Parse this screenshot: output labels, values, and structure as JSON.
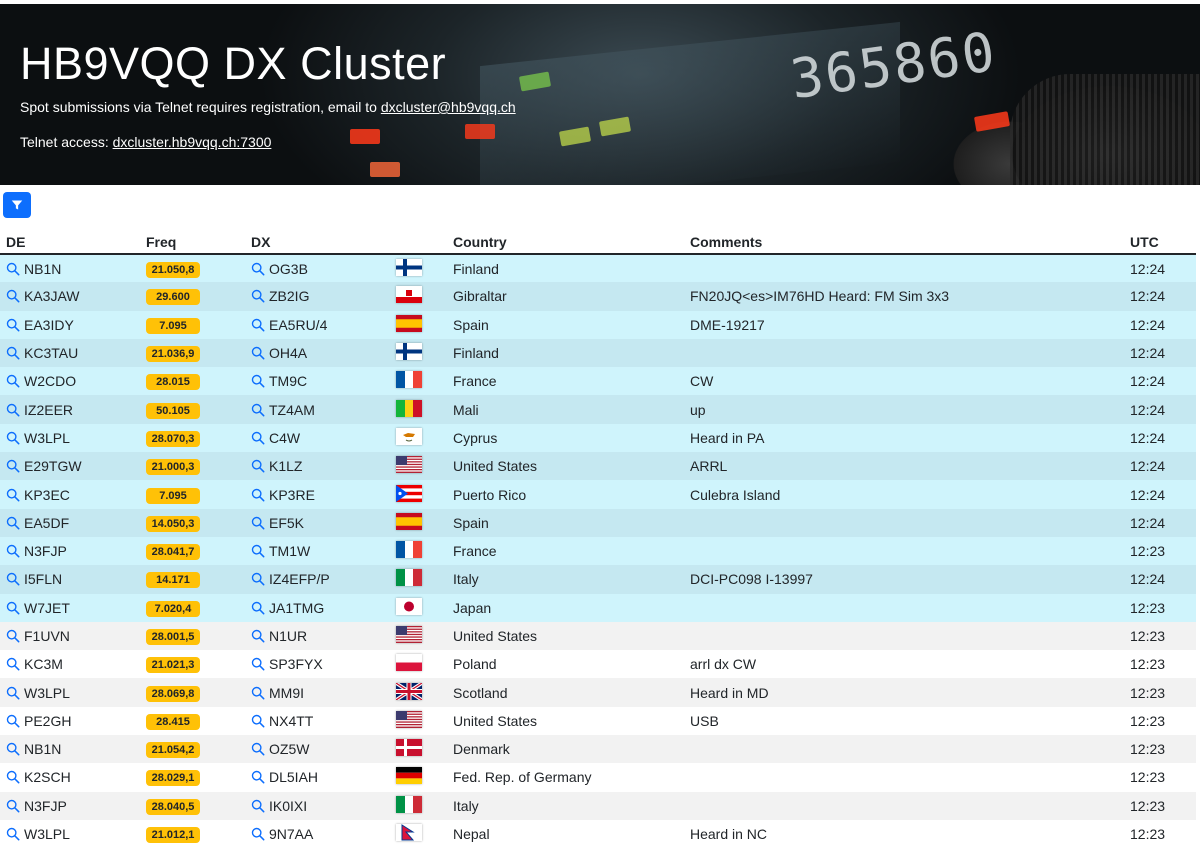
{
  "header": {
    "title": "HB9VQQ DX Cluster",
    "registration_text": "Spot submissions via Telnet requires registration, email to ",
    "email": "dxcluster@hb9vqq.ch",
    "telnet_label": "Telnet access: ",
    "telnet_address": "dxcluster.hb9vqq.ch:7300",
    "radio_display": "365860"
  },
  "filter_button": {
    "icon": "filter-icon",
    "color": "#0d6efd"
  },
  "colors": {
    "freq_badge": "#ffc107",
    "highlight_row": "#cff4fc",
    "link_icon": "#0d6efd"
  },
  "table": {
    "columns": [
      "DE",
      "Freq",
      "DX",
      "",
      "Country",
      "Comments",
      "UTC"
    ],
    "rows": [
      {
        "de": "NB1N",
        "freq": "21.050,8",
        "dx": "OG3B",
        "flag": "finland",
        "country": "Finland",
        "comments": "",
        "utc": "12:24",
        "highlight": true
      },
      {
        "de": "KA3JAW",
        "freq": "29.600",
        "dx": "ZB2IG",
        "flag": "gibraltar",
        "country": "Gibraltar",
        "comments": "FN20JQ<es>IM76HD Heard: FM Sim 3x3",
        "utc": "12:24",
        "highlight": true
      },
      {
        "de": "EA3IDY",
        "freq": "7.095",
        "dx": "EA5RU/4",
        "flag": "spain",
        "country": "Spain",
        "comments": "DME-19217",
        "utc": "12:24",
        "highlight": true
      },
      {
        "de": "KC3TAU",
        "freq": "21.036,9",
        "dx": "OH4A",
        "flag": "finland",
        "country": "Finland",
        "comments": "",
        "utc": "12:24",
        "highlight": true
      },
      {
        "de": "W2CDO",
        "freq": "28.015",
        "dx": "TM9C",
        "flag": "france",
        "country": "France",
        "comments": "CW",
        "utc": "12:24",
        "highlight": true
      },
      {
        "de": "IZ2EER",
        "freq": "50.105",
        "dx": "TZ4AM",
        "flag": "mali",
        "country": "Mali",
        "comments": "up",
        "utc": "12:24",
        "highlight": true
      },
      {
        "de": "W3LPL",
        "freq": "28.070,3",
        "dx": "C4W",
        "flag": "cyprus",
        "country": "Cyprus",
        "comments": "Heard in PA",
        "utc": "12:24",
        "highlight": true
      },
      {
        "de": "E29TGW",
        "freq": "21.000,3",
        "dx": "K1LZ",
        "flag": "usa",
        "country": "United States",
        "comments": "ARRL",
        "utc": "12:24",
        "highlight": true
      },
      {
        "de": "KP3EC",
        "freq": "7.095",
        "dx": "KP3RE",
        "flag": "puertorico",
        "country": "Puerto Rico",
        "comments": "Culebra Island",
        "utc": "12:24",
        "highlight": true
      },
      {
        "de": "EA5DF",
        "freq": "14.050,3",
        "dx": "EF5K",
        "flag": "spain",
        "country": "Spain",
        "comments": "",
        "utc": "12:24",
        "highlight": true
      },
      {
        "de": "N3FJP",
        "freq": "28.041,7",
        "dx": "TM1W",
        "flag": "france",
        "country": "France",
        "comments": "",
        "utc": "12:23",
        "highlight": true
      },
      {
        "de": "I5FLN",
        "freq": "14.171",
        "dx": "IZ4EFP/P",
        "flag": "italy",
        "country": "Italy",
        "comments": "DCI-PC098 I-13997",
        "utc": "12:24",
        "highlight": true
      },
      {
        "de": "W7JET",
        "freq": "7.020,4",
        "dx": "JA1TMG",
        "flag": "japan",
        "country": "Japan",
        "comments": "",
        "utc": "12:23",
        "highlight": true
      },
      {
        "de": "F1UVN",
        "freq": "28.001,5",
        "dx": "N1UR",
        "flag": "usa",
        "country": "United States",
        "comments": "",
        "utc": "12:23",
        "highlight": false
      },
      {
        "de": "KC3M",
        "freq": "21.021,3",
        "dx": "SP3FYX",
        "flag": "poland",
        "country": "Poland",
        "comments": "arrl dx CW",
        "utc": "12:23",
        "highlight": false
      },
      {
        "de": "W3LPL",
        "freq": "28.069,8",
        "dx": "MM9I",
        "flag": "uk",
        "country": "Scotland",
        "comments": "Heard in MD",
        "utc": "12:23",
        "highlight": false
      },
      {
        "de": "PE2GH",
        "freq": "28.415",
        "dx": "NX4TT",
        "flag": "usa",
        "country": "United States",
        "comments": "USB",
        "utc": "12:23",
        "highlight": false
      },
      {
        "de": "NB1N",
        "freq": "21.054,2",
        "dx": "OZ5W",
        "flag": "denmark",
        "country": "Denmark",
        "comments": "",
        "utc": "12:23",
        "highlight": false
      },
      {
        "de": "K2SCH",
        "freq": "28.029,1",
        "dx": "DL5IAH",
        "flag": "germany",
        "country": "Fed. Rep. of Germany",
        "comments": "",
        "utc": "12:23",
        "highlight": false
      },
      {
        "de": "N3FJP",
        "freq": "28.040,5",
        "dx": "IK0IXI",
        "flag": "italy",
        "country": "Italy",
        "comments": "",
        "utc": "12:23",
        "highlight": false
      },
      {
        "de": "W3LPL",
        "freq": "21.012,1",
        "dx": "9N7AA",
        "flag": "nepal",
        "country": "Nepal",
        "comments": "Heard in NC",
        "utc": "12:23",
        "highlight": false
      }
    ]
  }
}
